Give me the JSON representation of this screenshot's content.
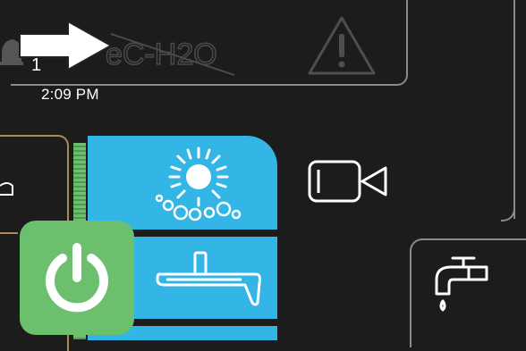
{
  "status": {
    "brand_logo_text": "eC-H2O",
    "notification_count": "1",
    "time": "2:09 PM"
  },
  "icons": {
    "pointer_arrow": "arrow-right-icon",
    "bell": "bell-icon",
    "warning": "warning-triangle-icon",
    "wash_mode": "sun-soap-bubbles-icon",
    "squeegee": "squeegee-icon",
    "camera": "camera-icon",
    "faucet": "faucet-icon",
    "power": "power-icon"
  },
  "colors": {
    "background": "#1c1c1c",
    "accent_blue": "#33b6e6",
    "power_green": "#6cbf6c",
    "frame_gray": "#8a8a8a",
    "tan": "#b0875a"
  }
}
